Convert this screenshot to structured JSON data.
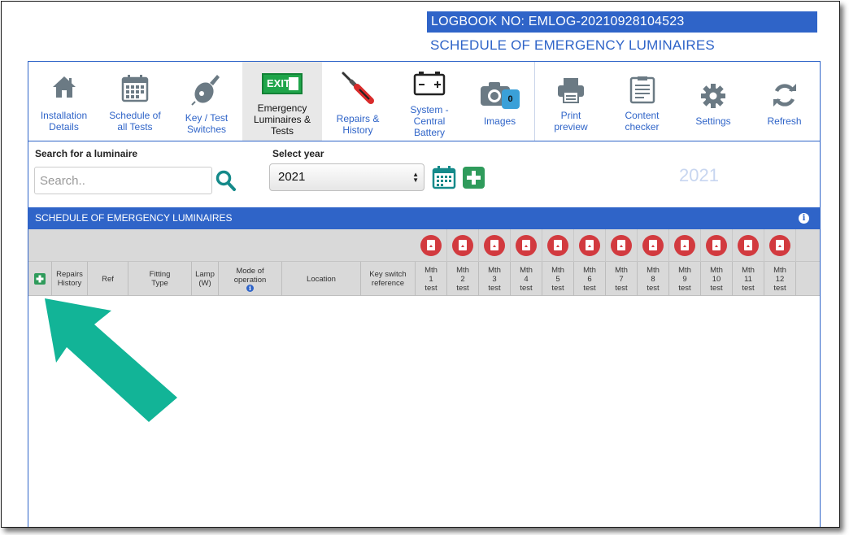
{
  "logbook": {
    "label": "LOGBOOK NO: EMLOG-20210928104523"
  },
  "page_title": "SCHEDULE OF EMERGENCY LUMINAIRES",
  "toolbar": {
    "installation": [
      "Installation",
      "Details"
    ],
    "schedule": [
      "Schedule of",
      "all Tests"
    ],
    "keytest": [
      "Key / Test",
      "Switches"
    ],
    "emergency": [
      "Emergency",
      "Luminaires &",
      "Tests"
    ],
    "exit_sign": "EXIT",
    "repairs": [
      "Repairs &",
      "History"
    ],
    "system": [
      "System -",
      "Central",
      "Battery"
    ],
    "images": "Images",
    "images_count": "0",
    "print": [
      "Print",
      "preview"
    ],
    "content": [
      "Content",
      "checker"
    ],
    "settings": "Settings",
    "refresh": "Refresh"
  },
  "search": {
    "label": "Search for a luminaire",
    "placeholder": "Search.."
  },
  "year": {
    "label": "Select year",
    "selected": "2021",
    "display": "2021"
  },
  "section": {
    "title": "SCHEDULE OF EMERGENCY LUMINAIRES"
  },
  "table": {
    "columns": {
      "repairs": [
        "Repairs",
        "History"
      ],
      "ref": "Ref",
      "fitting": [
        "Fitting",
        "Type"
      ],
      "lamp": [
        "Lamp",
        "(W)"
      ],
      "mode": [
        "Mode of",
        "operation"
      ],
      "location": "Location",
      "keyswitch": [
        "Key switch",
        "reference"
      ]
    },
    "months": [
      [
        "Mth",
        "1",
        "test"
      ],
      [
        "Mth",
        "2",
        "test"
      ],
      [
        "Mth",
        "3",
        "test"
      ],
      [
        "Mth",
        "4",
        "test"
      ],
      [
        "Mth",
        "5",
        "test"
      ],
      [
        "Mth",
        "6",
        "test"
      ],
      [
        "Mth",
        "7",
        "test"
      ],
      [
        "Mth",
        "8",
        "test"
      ],
      [
        "Mth",
        "9",
        "test"
      ],
      [
        "Mth",
        "10",
        "test"
      ],
      [
        "Mth",
        "11",
        "test"
      ],
      [
        "Mth",
        "12",
        "test"
      ]
    ]
  },
  "colors": {
    "accent": "#2f64c8",
    "green": "#2f9b5b",
    "pdf_red": "#d23a3f",
    "arrow": "#12b497"
  }
}
